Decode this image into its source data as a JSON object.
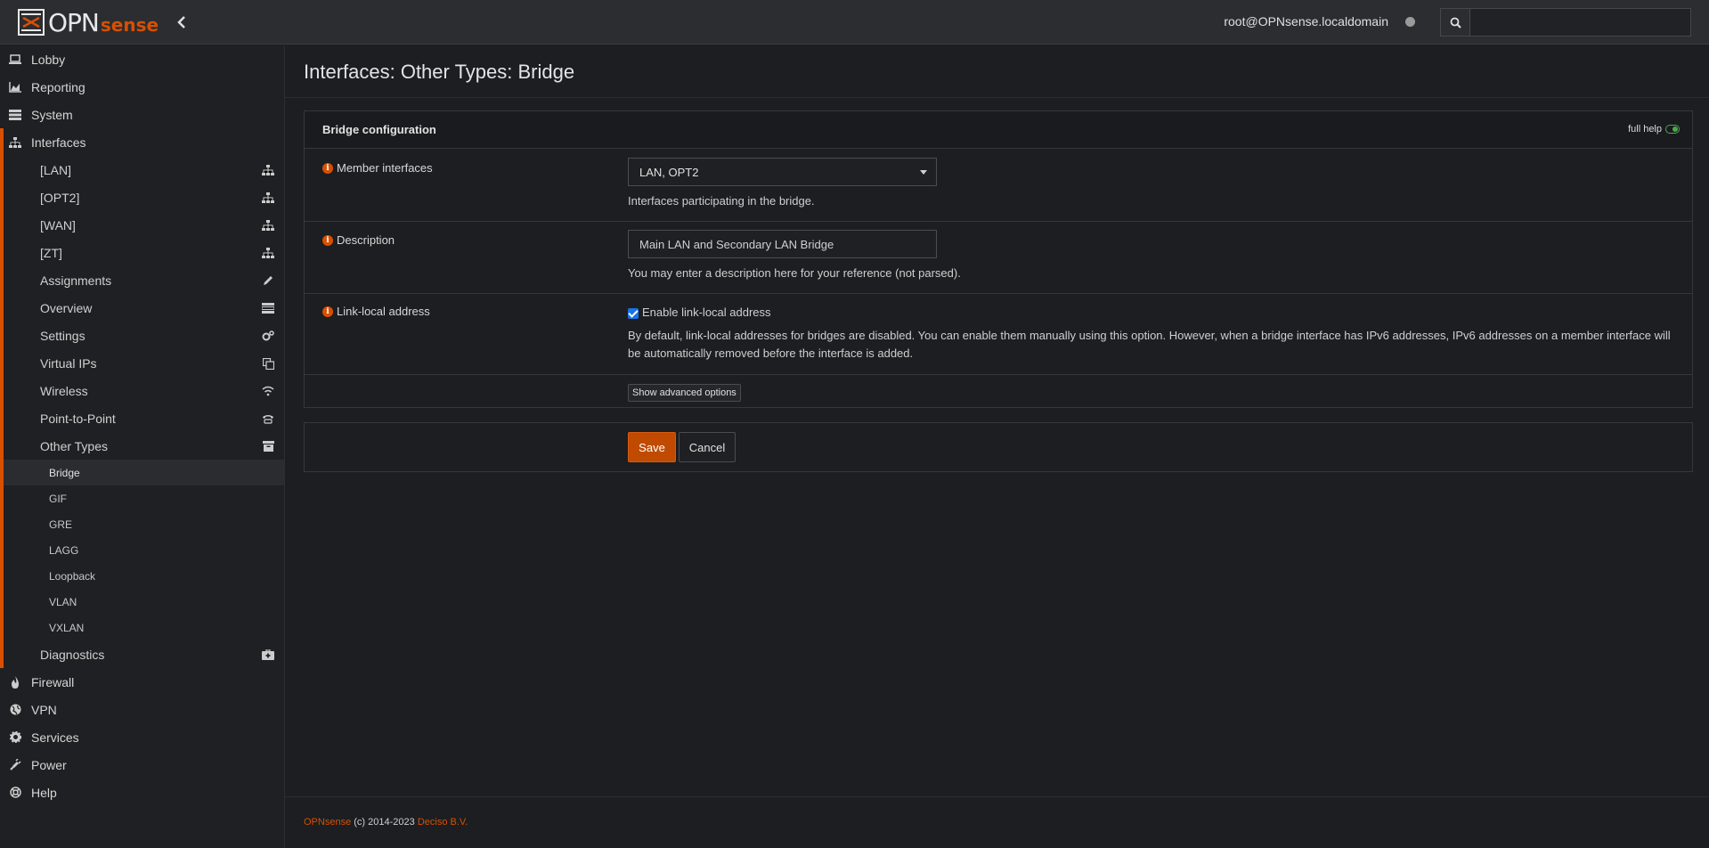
{
  "brand": {
    "logo_main": "OPN",
    "logo_sub": "sense"
  },
  "header": {
    "user": "root@OPNsense.localdomain",
    "search_placeholder": ""
  },
  "sidebar": {
    "top": [
      {
        "label": "Lobby",
        "icon": "laptop-icon"
      },
      {
        "label": "Reporting",
        "icon": "area-chart-icon"
      },
      {
        "label": "System",
        "icon": "server-icon"
      },
      {
        "label": "Interfaces",
        "icon": "sitemap-icon"
      }
    ],
    "interfaces_items": [
      {
        "label": "[LAN]",
        "icon": "sitemap-icon"
      },
      {
        "label": "[OPT2]",
        "icon": "sitemap-icon"
      },
      {
        "label": "[WAN]",
        "icon": "sitemap-icon"
      },
      {
        "label": "[ZT]",
        "icon": "sitemap-icon"
      },
      {
        "label": "Assignments",
        "icon": "pencil-icon"
      },
      {
        "label": "Overview",
        "icon": "tasks-icon"
      },
      {
        "label": "Settings",
        "icon": "cogs-icon"
      },
      {
        "label": "Virtual IPs",
        "icon": "clone-icon"
      },
      {
        "label": "Wireless",
        "icon": "wifi-icon"
      },
      {
        "label": "Point-to-Point",
        "icon": "phone-icon"
      },
      {
        "label": "Other Types",
        "icon": "archive-icon"
      }
    ],
    "other_types": [
      "Bridge",
      "GIF",
      "GRE",
      "LAGG",
      "Loopback",
      "VLAN",
      "VXLAN"
    ],
    "diagnostics": {
      "label": "Diagnostics",
      "icon": "medkit-icon"
    },
    "bottom": [
      {
        "label": "Firewall",
        "icon": "fire-icon"
      },
      {
        "label": "VPN",
        "icon": "globe-icon"
      },
      {
        "label": "Services",
        "icon": "cog-icon"
      },
      {
        "label": "Power",
        "icon": "plug-icon"
      },
      {
        "label": "Help",
        "icon": "support-icon"
      }
    ]
  },
  "page": {
    "title": "Interfaces: Other Types: Bridge",
    "panel_title": "Bridge configuration",
    "full_help": "full help",
    "member": {
      "label": "Member interfaces",
      "value": "LAN, OPT2",
      "hint": "Interfaces participating in the bridge."
    },
    "description": {
      "label": "Description",
      "value": "Main LAN and Secondary LAN Bridge",
      "hint": "You may enter a description here for your reference (not parsed)."
    },
    "linklocal": {
      "label": "Link-local address",
      "checkbox_label": "Enable link-local address",
      "checked": true,
      "hint": "By default, link-local addresses for bridges are disabled. You can enable them manually using this option. However, when a bridge interface has IPv6 addresses, IPv6 addresses on a member interface will be automatically removed before the interface is added."
    },
    "advanced_button": "Show advanced options",
    "save": "Save",
    "cancel": "Cancel"
  },
  "footer": {
    "brand": "OPNsense",
    "copyright": "(c) 2014-2023",
    "company": "Deciso B.V."
  },
  "colors": {
    "accent": "#d94f00",
    "bg": "#1c1e21",
    "save": "#c04a00"
  }
}
